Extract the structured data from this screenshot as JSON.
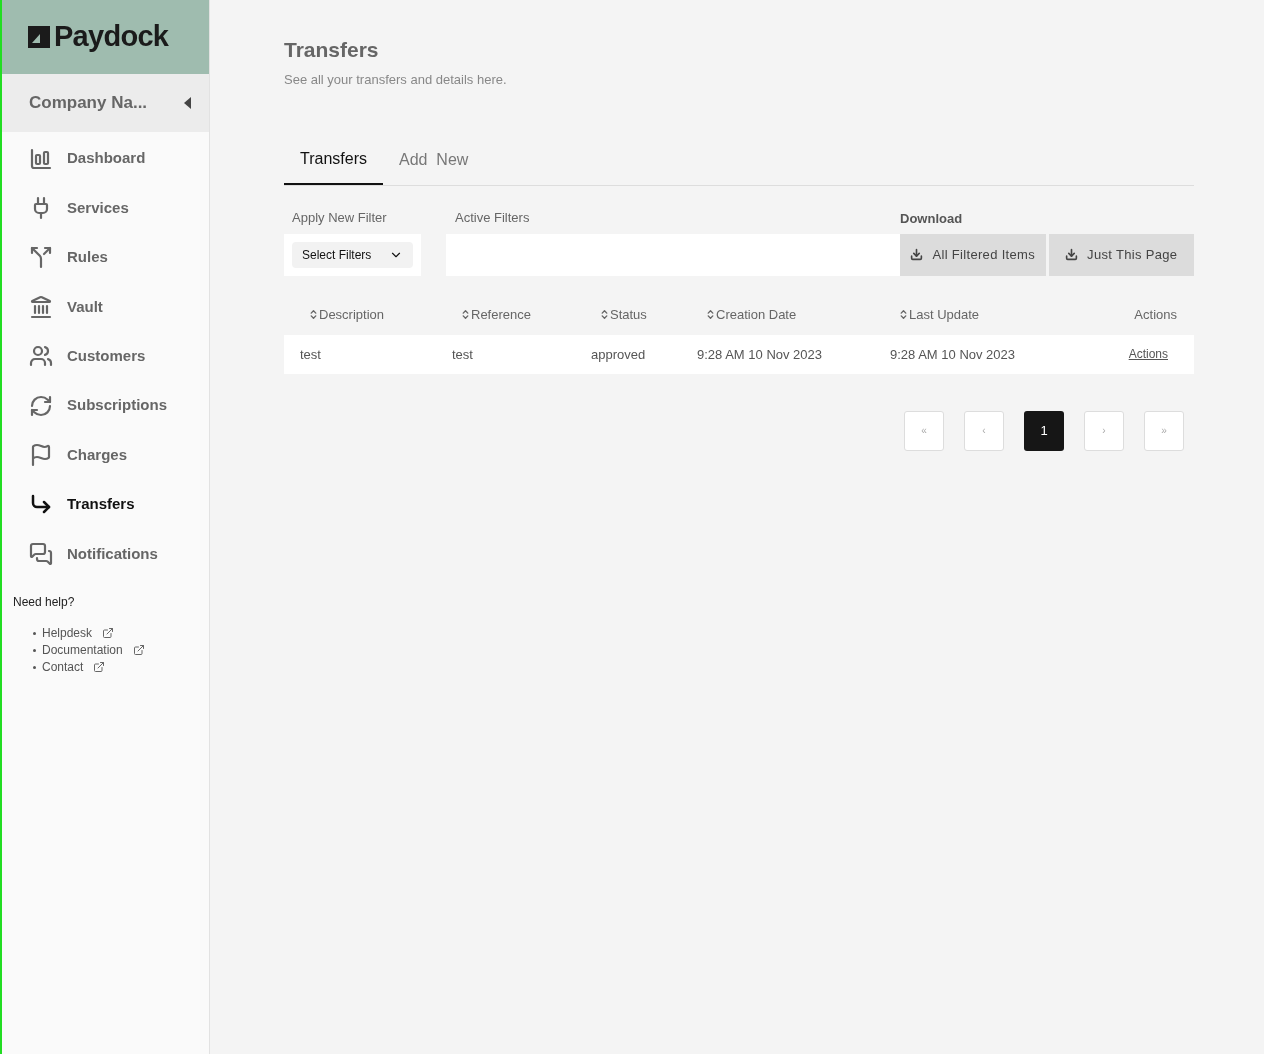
{
  "brand": {
    "name": "Paydock"
  },
  "company": {
    "name": "Company Na..."
  },
  "sidebar": {
    "items": [
      {
        "label": "Dashboard",
        "selected": false
      },
      {
        "label": "Services",
        "selected": false
      },
      {
        "label": "Rules",
        "selected": false
      },
      {
        "label": "Vault",
        "selected": false
      },
      {
        "label": "Customers",
        "selected": false
      },
      {
        "label": "Subscriptions",
        "selected": false
      },
      {
        "label": "Charges",
        "selected": false
      },
      {
        "label": "Transfers",
        "selected": true
      },
      {
        "label": "Notifications",
        "selected": false
      }
    ]
  },
  "help": {
    "title": "Need help?",
    "links": [
      "Helpdesk",
      "Documentation",
      "Contact"
    ]
  },
  "page": {
    "title": "Transfers",
    "subtitle": "See all your transfers and details here."
  },
  "tabs": [
    {
      "label": "Transfers",
      "selected": true
    },
    {
      "label": "Add  New",
      "selected": false
    }
  ],
  "filters": {
    "apply_label": "Apply New Filter",
    "select": "Select Filters",
    "active_label": "Active Filters"
  },
  "download": {
    "label": "Download",
    "buttons": [
      "All Filtered Items",
      "Just This Page"
    ]
  },
  "table": {
    "columns": [
      {
        "label": "Description",
        "sortable": true
      },
      {
        "label": "Reference",
        "sortable": true
      },
      {
        "label": "Status",
        "sortable": true
      },
      {
        "label": "Creation Date",
        "sortable": true
      },
      {
        "label": "Last Update",
        "sortable": true
      },
      {
        "label": "Actions",
        "sortable": false
      }
    ],
    "rows": [
      {
        "cells": [
          "test",
          "test",
          "approved",
          "9:28 AM 10 Nov 2023",
          "9:28 AM 10 Nov 2023"
        ],
        "action": "Actions"
      }
    ]
  },
  "pagination": [
    {
      "label": "«",
      "selected": false
    },
    {
      "label": "‹",
      "selected": false
    },
    {
      "label": "1",
      "selected": true
    },
    {
      "label": "›",
      "selected": false
    },
    {
      "label": "»",
      "selected": false
    }
  ]
}
